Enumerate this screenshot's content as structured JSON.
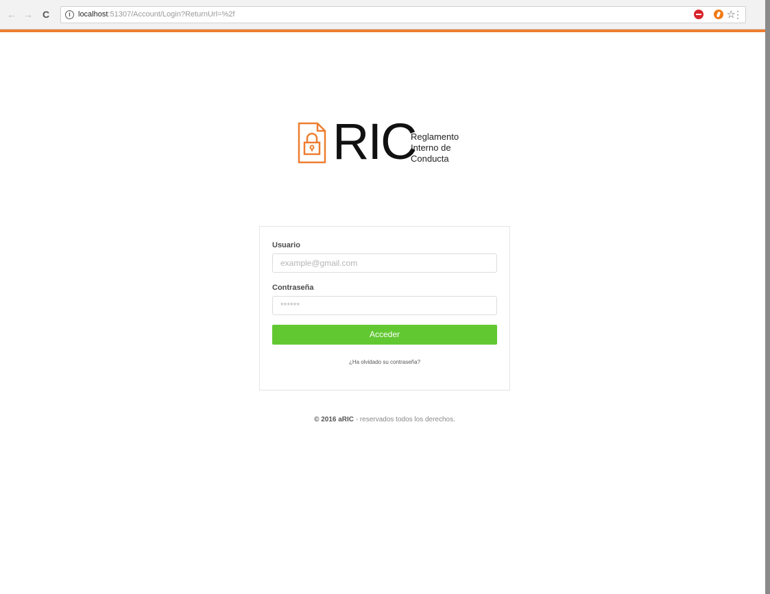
{
  "browser": {
    "url_host": "localhost",
    "url_rest": ":51307/Account/Login?ReturnUrl=%2f",
    "back_icon": "←",
    "forward_icon": "→",
    "reload_icon": "C",
    "info_icon": "ⓘ",
    "star_icon": "☆",
    "menu_icon": "⋮",
    "accent_color": "#ee7d2f"
  },
  "logo": {
    "wordmark": "RIC",
    "subtitle_lines": [
      "Reglamento",
      "Interno de",
      "Conducta"
    ],
    "icon_color": "#ee7d2f"
  },
  "form": {
    "username_label": "Usuario",
    "username_placeholder": "example@gmail.com",
    "password_label": "Contraseña",
    "password_placeholder": "******",
    "submit_label": "Acceder",
    "submit_color": "#62c832",
    "forgot_link": "¿Ha olvidado su contraseña?"
  },
  "footer": {
    "copyright": "© 2016 aRIC",
    "rest": " - reservados todos los derechos."
  }
}
